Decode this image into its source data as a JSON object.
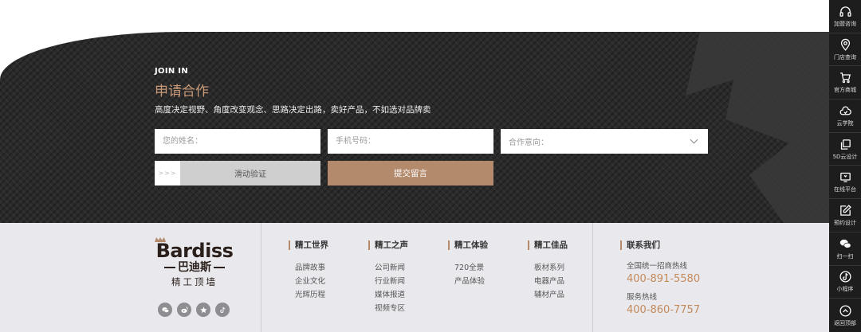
{
  "join": {
    "label": "JOIN IN",
    "title": "申请合作",
    "subtitle": "高度决定视野、角度改变观念、思路决定出路，卖好产品，不如选对品牌卖",
    "name_placeholder": "您的姓名：",
    "phone_placeholder": "手机号码：",
    "intent_placeholder": "合作意向：",
    "slider_handle": ">>>",
    "slider_text": "滑动验证",
    "submit_label": "提交留言"
  },
  "brand": {
    "en": "Bardiss",
    "cn": "巴迪斯",
    "slogan": "精工顶墙"
  },
  "social_icons": [
    "wechat-icon",
    "weibo-icon",
    "star-icon",
    "tiktok-icon"
  ],
  "footer_columns": [
    {
      "title": "精工世界",
      "items": [
        "品牌故事",
        "企业文化",
        "光辉历程"
      ]
    },
    {
      "title": "精工之声",
      "items": [
        "公司新闻",
        "行业新闻",
        "媒体报道",
        "视频专区"
      ]
    },
    {
      "title": "精工体验",
      "items": [
        "720全景",
        "产品体验"
      ]
    },
    {
      "title": "精工佳品",
      "items": [
        "板材系列",
        "电器产品",
        "辅材产品"
      ]
    }
  ],
  "contact": {
    "title": "联系我们",
    "hotline_label": "全国统一招商热线",
    "hotline": "400-891-5580",
    "service_label": "服务热线",
    "service": "400-860-7757"
  },
  "sidebar": [
    {
      "icon": "headset-icon",
      "label": "加盟咨询"
    },
    {
      "icon": "location-icon",
      "label": "门店查询"
    },
    {
      "icon": "cart-icon",
      "label": "官方商城"
    },
    {
      "icon": "cloud-icon",
      "label": "云学院"
    },
    {
      "icon": "copy-icon",
      "label": "5D云设计"
    },
    {
      "icon": "monitor-icon",
      "label": "在线平台"
    },
    {
      "icon": "edit-icon",
      "label": "预约设计"
    },
    {
      "icon": "wechat-icon",
      "label": "扫一扫"
    },
    {
      "icon": "tiktok-icon",
      "label": "小程序"
    },
    {
      "icon": "chevron-up-icon",
      "label": "返回顶部"
    }
  ],
  "colors": {
    "accent": "#b48a6c",
    "title_accent": "#c99a78",
    "phone": "#c48a5a",
    "hero_bg": "#2b2a2b",
    "footer_bg": "#e9e9ed",
    "sidebar_bg": "#1d1d1d"
  }
}
